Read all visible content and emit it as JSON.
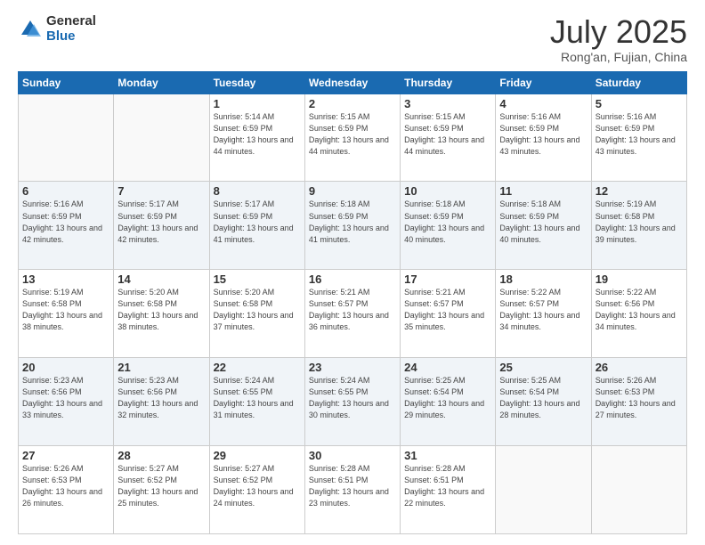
{
  "logo": {
    "general": "General",
    "blue": "Blue"
  },
  "header": {
    "month": "July 2025",
    "location": "Rong'an, Fujian, China"
  },
  "days_of_week": [
    "Sunday",
    "Monday",
    "Tuesday",
    "Wednesday",
    "Thursday",
    "Friday",
    "Saturday"
  ],
  "weeks": [
    [
      {
        "day": "",
        "info": ""
      },
      {
        "day": "",
        "info": ""
      },
      {
        "day": "1",
        "info": "Sunrise: 5:14 AM\nSunset: 6:59 PM\nDaylight: 13 hours and 44 minutes."
      },
      {
        "day": "2",
        "info": "Sunrise: 5:15 AM\nSunset: 6:59 PM\nDaylight: 13 hours and 44 minutes."
      },
      {
        "day": "3",
        "info": "Sunrise: 5:15 AM\nSunset: 6:59 PM\nDaylight: 13 hours and 44 minutes."
      },
      {
        "day": "4",
        "info": "Sunrise: 5:16 AM\nSunset: 6:59 PM\nDaylight: 13 hours and 43 minutes."
      },
      {
        "day": "5",
        "info": "Sunrise: 5:16 AM\nSunset: 6:59 PM\nDaylight: 13 hours and 43 minutes."
      }
    ],
    [
      {
        "day": "6",
        "info": "Sunrise: 5:16 AM\nSunset: 6:59 PM\nDaylight: 13 hours and 42 minutes."
      },
      {
        "day": "7",
        "info": "Sunrise: 5:17 AM\nSunset: 6:59 PM\nDaylight: 13 hours and 42 minutes."
      },
      {
        "day": "8",
        "info": "Sunrise: 5:17 AM\nSunset: 6:59 PM\nDaylight: 13 hours and 41 minutes."
      },
      {
        "day": "9",
        "info": "Sunrise: 5:18 AM\nSunset: 6:59 PM\nDaylight: 13 hours and 41 minutes."
      },
      {
        "day": "10",
        "info": "Sunrise: 5:18 AM\nSunset: 6:59 PM\nDaylight: 13 hours and 40 minutes."
      },
      {
        "day": "11",
        "info": "Sunrise: 5:18 AM\nSunset: 6:59 PM\nDaylight: 13 hours and 40 minutes."
      },
      {
        "day": "12",
        "info": "Sunrise: 5:19 AM\nSunset: 6:58 PM\nDaylight: 13 hours and 39 minutes."
      }
    ],
    [
      {
        "day": "13",
        "info": "Sunrise: 5:19 AM\nSunset: 6:58 PM\nDaylight: 13 hours and 38 minutes."
      },
      {
        "day": "14",
        "info": "Sunrise: 5:20 AM\nSunset: 6:58 PM\nDaylight: 13 hours and 38 minutes."
      },
      {
        "day": "15",
        "info": "Sunrise: 5:20 AM\nSunset: 6:58 PM\nDaylight: 13 hours and 37 minutes."
      },
      {
        "day": "16",
        "info": "Sunrise: 5:21 AM\nSunset: 6:57 PM\nDaylight: 13 hours and 36 minutes."
      },
      {
        "day": "17",
        "info": "Sunrise: 5:21 AM\nSunset: 6:57 PM\nDaylight: 13 hours and 35 minutes."
      },
      {
        "day": "18",
        "info": "Sunrise: 5:22 AM\nSunset: 6:57 PM\nDaylight: 13 hours and 34 minutes."
      },
      {
        "day": "19",
        "info": "Sunrise: 5:22 AM\nSunset: 6:56 PM\nDaylight: 13 hours and 34 minutes."
      }
    ],
    [
      {
        "day": "20",
        "info": "Sunrise: 5:23 AM\nSunset: 6:56 PM\nDaylight: 13 hours and 33 minutes."
      },
      {
        "day": "21",
        "info": "Sunrise: 5:23 AM\nSunset: 6:56 PM\nDaylight: 13 hours and 32 minutes."
      },
      {
        "day": "22",
        "info": "Sunrise: 5:24 AM\nSunset: 6:55 PM\nDaylight: 13 hours and 31 minutes."
      },
      {
        "day": "23",
        "info": "Sunrise: 5:24 AM\nSunset: 6:55 PM\nDaylight: 13 hours and 30 minutes."
      },
      {
        "day": "24",
        "info": "Sunrise: 5:25 AM\nSunset: 6:54 PM\nDaylight: 13 hours and 29 minutes."
      },
      {
        "day": "25",
        "info": "Sunrise: 5:25 AM\nSunset: 6:54 PM\nDaylight: 13 hours and 28 minutes."
      },
      {
        "day": "26",
        "info": "Sunrise: 5:26 AM\nSunset: 6:53 PM\nDaylight: 13 hours and 27 minutes."
      }
    ],
    [
      {
        "day": "27",
        "info": "Sunrise: 5:26 AM\nSunset: 6:53 PM\nDaylight: 13 hours and 26 minutes."
      },
      {
        "day": "28",
        "info": "Sunrise: 5:27 AM\nSunset: 6:52 PM\nDaylight: 13 hours and 25 minutes."
      },
      {
        "day": "29",
        "info": "Sunrise: 5:27 AM\nSunset: 6:52 PM\nDaylight: 13 hours and 24 minutes."
      },
      {
        "day": "30",
        "info": "Sunrise: 5:28 AM\nSunset: 6:51 PM\nDaylight: 13 hours and 23 minutes."
      },
      {
        "day": "31",
        "info": "Sunrise: 5:28 AM\nSunset: 6:51 PM\nDaylight: 13 hours and 22 minutes."
      },
      {
        "day": "",
        "info": ""
      },
      {
        "day": "",
        "info": ""
      }
    ]
  ]
}
